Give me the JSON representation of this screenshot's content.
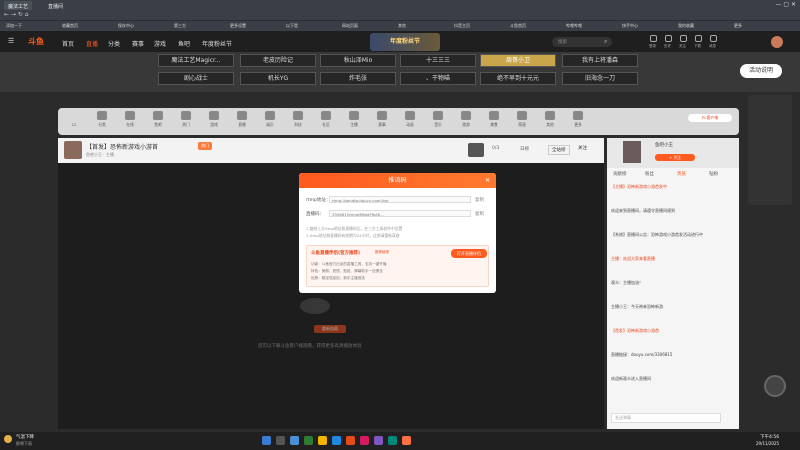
{
  "browser": {
    "tabs": [
      "魔法工艺",
      "直播间",
      "Microsoft Edge"
    ],
    "url": "https://www.douyu.com/3306815/...",
    "bookmarks": [
      "添加一下",
      "收藏首页",
      "保存中心",
      "第三方",
      "更多设置",
      "以下是",
      "网站页面",
      "其他",
      "抖音主页",
      "斗鱼首页",
      "哔哩哔哩",
      "快手中心",
      "我的收藏",
      "更多"
    ]
  },
  "site": {
    "logo": "斗鱼",
    "nav": [
      "首页",
      "直播",
      "分类",
      "赛事",
      "游戏",
      "鱼吧",
      "年度粉丝节"
    ],
    "search_placeholder": "搜索",
    "user_icons": [
      "登录",
      "历史",
      "关注",
      "下载",
      "消息"
    ],
    "banner_event": "年度粉丝节"
  },
  "banner": {
    "row1": [
      "魔法工艺Magicr...",
      "老皮历险记",
      "秋山泽Mio",
      "十三三三",
      "周哥小卫",
      "我有上将潘森"
    ],
    "row2": [
      "剧心战士",
      "机长YG",
      "炸毛张",
      "、干物喵",
      "绝不早到十元元",
      "旧海念一刀"
    ],
    "live_button": "活动说明"
  },
  "categories": [
    "12",
    "分类",
    "在线",
    "鱼吧",
    "热门",
    "游戏",
    "直播",
    "娱乐",
    "科技",
    "社区",
    "主播",
    "赛事",
    "动画",
    "音乐",
    "旅游",
    "美食",
    "萌宠",
    "其他",
    "更多"
  ],
  "room": {
    "title": "【首发】恐怖新游戏小游首",
    "tag": "热门",
    "subtitle": "鱼吧小王 · 主播",
    "stats": [
      "0/3",
      "日榜",
      "全站榜"
    ],
    "follow": "关注"
  },
  "player": {
    "bottom_text": "您可以下载斗鱼客户端观看，获得更多高清播放体验",
    "button": "重新加载"
  },
  "modal": {
    "title": "推流码",
    "rtmp_label": "rtmp地址：",
    "rtmp_value": "rtmp://sendfw.douyu.com/live",
    "key_label": "直播码：",
    "key_value": "3306815rtmpMBwdF6jAK...",
    "copy": "复制",
    "note1": "1.复制上方rtmp地址和直播码后，在三方工具软件中设置",
    "note2": "2.rtmp地址和直播码有效期为24小时，过期请重新获取",
    "promo_title": "斗鱼直播伴侣(官方推荐)",
    "promo_badge": "推荐使用",
    "promo_lines": [
      "功能：斗鱼官方出品的直播工具，支持一键开播",
      "特色：美颜、滤镜、贴纸、弹幕助手一应俱全",
      "优势：稳定低延迟，新手主播首选"
    ],
    "open_button": "打开直播伴侣"
  },
  "sidebar": {
    "anchor": "鱼吧小王",
    "follow_btn": "+ 关注",
    "tabs": [
      "贡献榜",
      "粉丝",
      "贵族",
      "钻粉"
    ],
    "chat": [
      "【主播】恐怖新游戏小游首发中",
      "欢迎来到直播间，请遵守直播间规则",
      "【系统】直播间公告：恐怖游戏小游首发活动进行中",
      "主播：欢迎大家来看直播",
      "观众：主播加油！",
      "主播小王：今天带来恐怖新游",
      "【首发】恐怖新游戏小游首",
      "直播链接：douyu.com/3306815",
      "欢迎新观众进入直播间"
    ],
    "input_placeholder": "发送弹幕"
  },
  "taskbar": {
    "weather": "气温下降",
    "weather_sub": "即将下雨",
    "time": "下午4:56",
    "date": "29/11/2025"
  }
}
